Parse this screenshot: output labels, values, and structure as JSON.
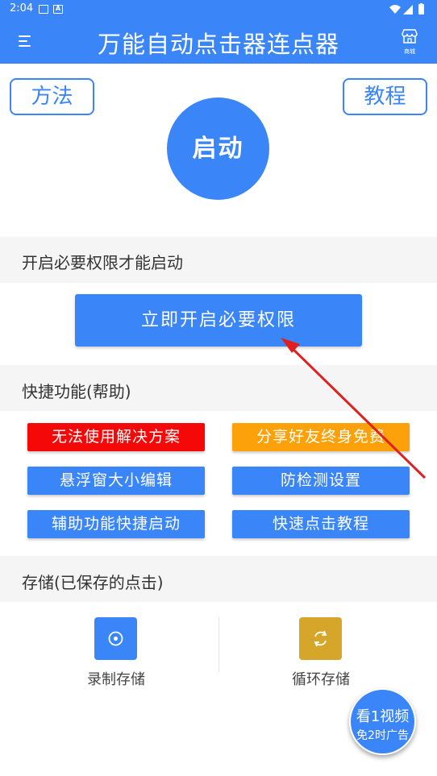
{
  "status_bar": {
    "time": "2:04",
    "left_icons": [
      "image-icon",
      "a-icon"
    ],
    "right_icons": [
      "wifi-icon",
      "signal-icon",
      "battery-icon"
    ]
  },
  "app_bar": {
    "title": "万能自动点击器连点器",
    "store_label": "商城",
    "color": "#3a86f8"
  },
  "top": {
    "method_label": "方法",
    "tutorial_label": "教程",
    "start_label": "启动"
  },
  "permission_section": {
    "header": "开启必要权限才能启动",
    "button_label": "立即开启必要权限"
  },
  "shortcut_section": {
    "header": "快捷功能(帮助)",
    "buttons": [
      {
        "label": "无法使用解决方案",
        "color": "#f50808"
      },
      {
        "label": "分享好友终身免费",
        "color": "#fca10a"
      },
      {
        "label": "悬浮窗大小编辑",
        "color": "#3a86f8"
      },
      {
        "label": "防检测设置",
        "color": "#3a86f8"
      },
      {
        "label": "辅助功能快捷启动",
        "color": "#3a86f8"
      },
      {
        "label": "快速点击教程",
        "color": "#3a86f8"
      }
    ]
  },
  "storage_section": {
    "header": "存储(已保存的点击)",
    "items": [
      {
        "label": "录制存储",
        "icon": "record-icon",
        "color": "#3a86f8"
      },
      {
        "label": "循环存储",
        "icon": "loop-icon",
        "color": "#d6a62b"
      }
    ]
  },
  "fab": {
    "line1": "看1视频",
    "line2": "免2时广告"
  },
  "annotation_color": "#e02020"
}
